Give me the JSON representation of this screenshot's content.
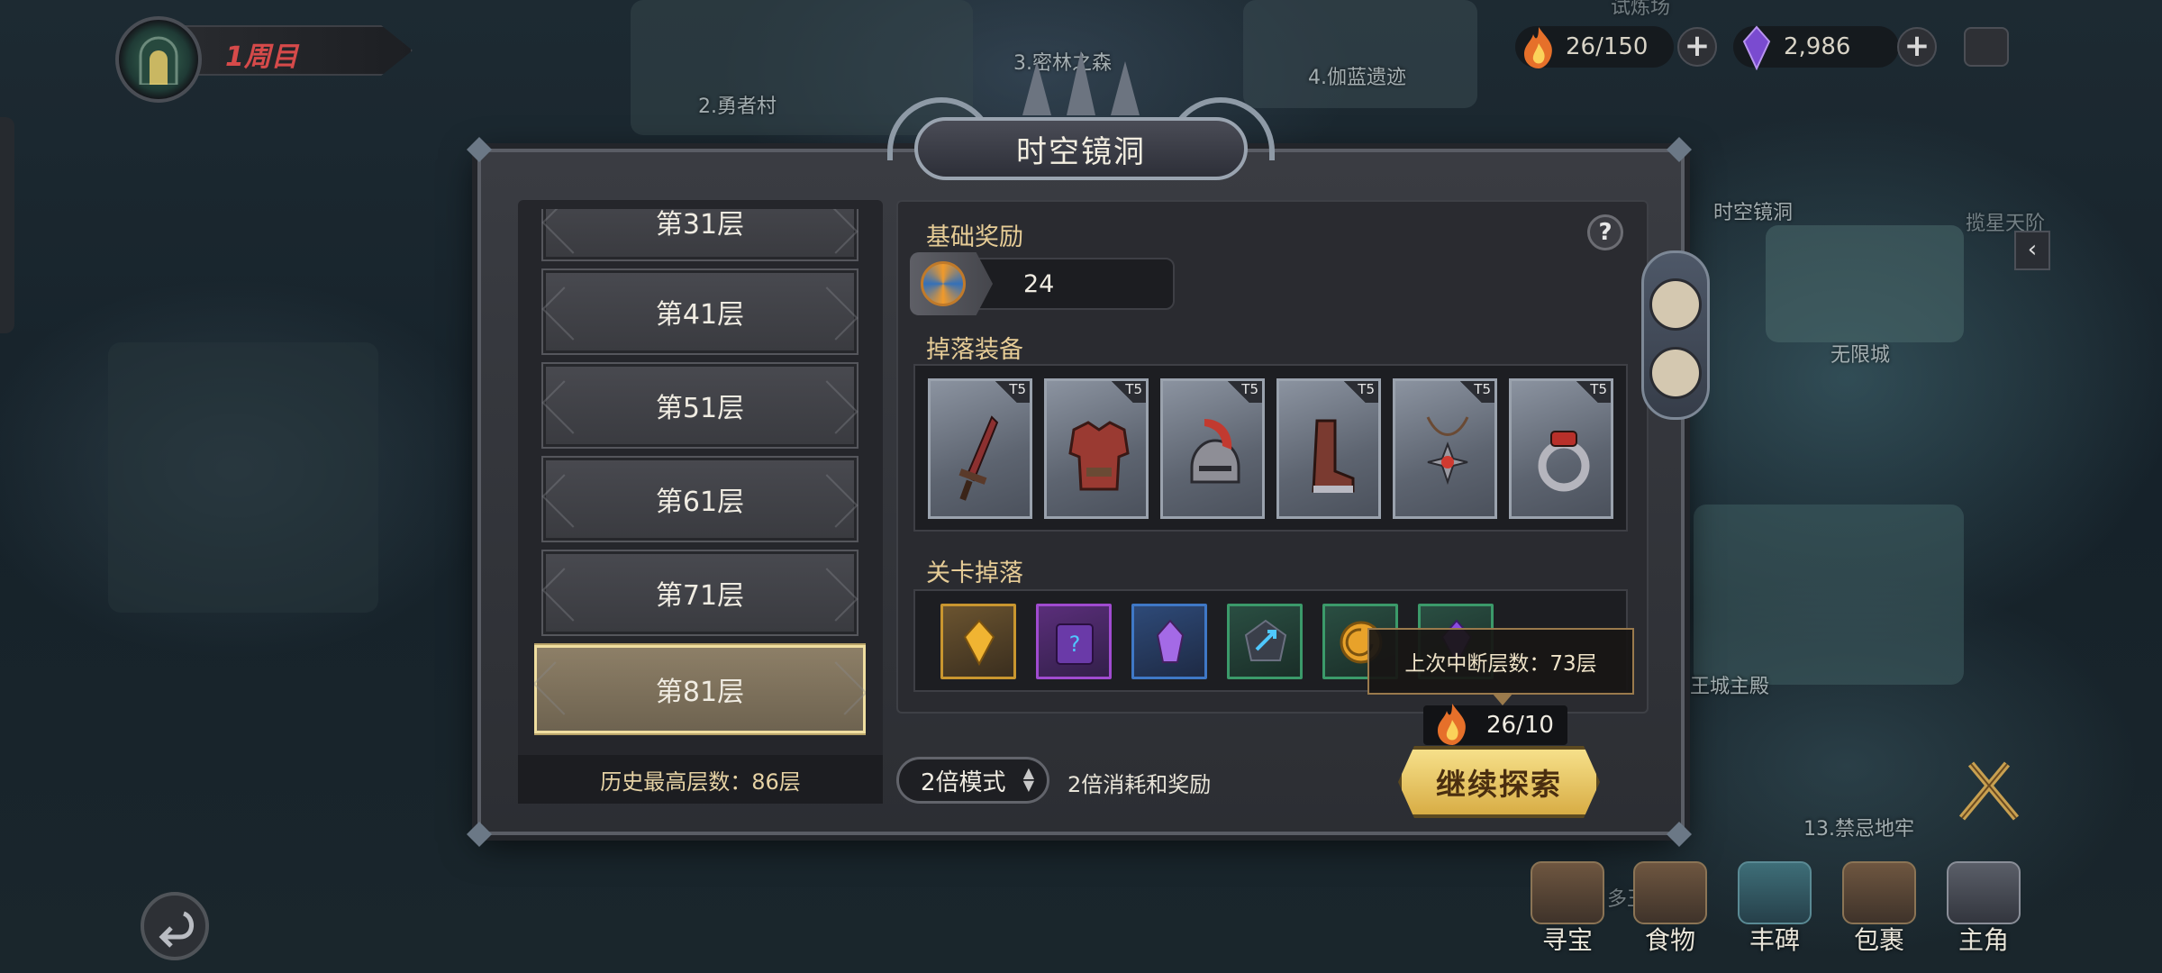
{
  "cycle": {
    "label": "1周目"
  },
  "resources": {
    "stamina": "26/150",
    "gems": "2,986"
  },
  "map_labels": [
    "2.勇者村",
    "3.密林之森",
    "4.伽蓝遗迹",
    "时空镜洞",
    "揽星天阶",
    "无限城",
    "王城主殿",
    "13.禁忌地牢",
    "试炼场",
    "多王"
  ],
  "modal": {
    "title": "时空镜洞",
    "floors": [
      "第31层",
      "第41层",
      "第51层",
      "第61层",
      "第71层",
      "第81层"
    ],
    "selected_floor": "第81层",
    "history": "历史最高层数：86层",
    "base_reward": {
      "title": "基础奖励",
      "value": "24"
    },
    "equipment": {
      "title": "掉落装备",
      "items": [
        {
          "name": "sword",
          "tier": "T5"
        },
        {
          "name": "armor",
          "tier": "T5"
        },
        {
          "name": "helmet",
          "tier": "T5"
        },
        {
          "name": "boots",
          "tier": "T5"
        },
        {
          "name": "amulet",
          "tier": "T5"
        },
        {
          "name": "ring",
          "tier": "T5"
        }
      ]
    },
    "stage_drops": {
      "title": "关卡掉落",
      "items": [
        {
          "name": "gold-crystal",
          "border": "#c9962f"
        },
        {
          "name": "purple-book",
          "border": "#a04bd0"
        },
        {
          "name": "purple-crystal",
          "border": "#3f78c6"
        },
        {
          "name": "blue-rune",
          "border": "#3b9a6a"
        },
        {
          "name": "gold-coin",
          "border": "#3b9a6a"
        },
        {
          "name": "purple-gem",
          "border": "#3b9a6a"
        }
      ]
    },
    "tooltip": "上次中断层数：73层",
    "stamina_cost": "26/10",
    "mode": "2倍模式",
    "mode_desc": "2倍消耗和奖励",
    "continue_label": "继续探索"
  },
  "bottom_nav": [
    "寻宝",
    "食物",
    "丰碑",
    "包裹",
    "主角"
  ],
  "colors": {
    "accent_gold": "#e6cc96",
    "button_gold": "#f6e08a",
    "cycle_red": "#d64a4a"
  }
}
